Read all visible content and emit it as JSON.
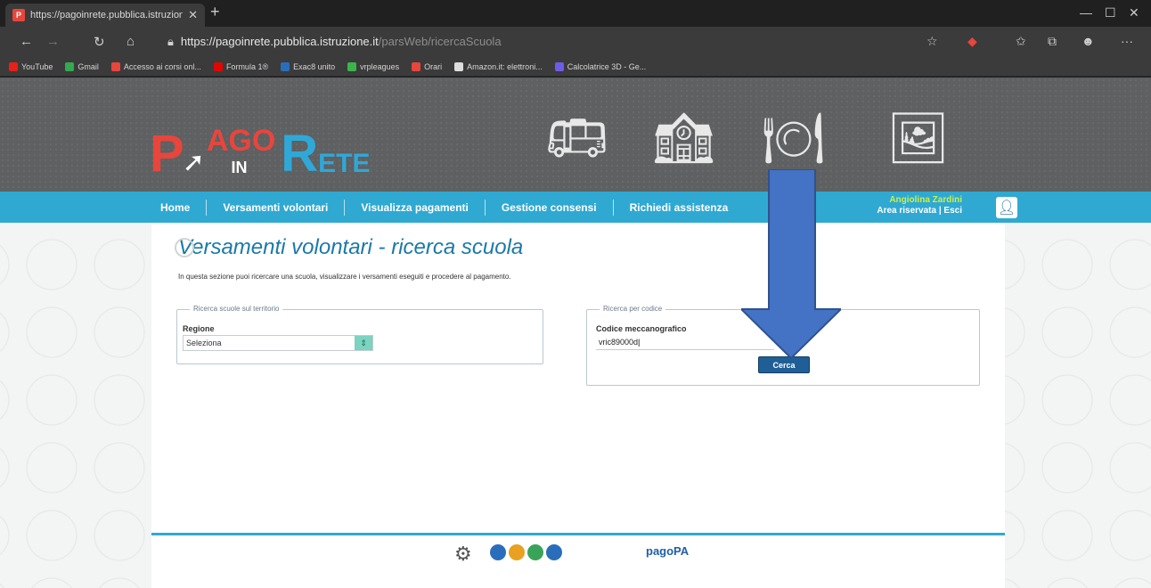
{
  "browser": {
    "tab_title": "https://pagoinrete.pubblica.istruzione.it",
    "new_tab": "+",
    "url_host": "https://pagoinrete.pubblica.istruzione.it",
    "url_path": "/parsWeb/ricercaScuola",
    "bookmarks": [
      {
        "label": "YouTube",
        "color": "#e62117"
      },
      {
        "label": "Gmail",
        "color": "#34a853"
      },
      {
        "label": "Accesso ai corsi onl...",
        "color": "#e8453c"
      },
      {
        "label": "Formula 1®",
        "color": "#e10600"
      },
      {
        "label": "Exac8 unito",
        "color": "#2a6ebb"
      },
      {
        "label": "vrpleagues",
        "color": "#3bb54a"
      },
      {
        "label": "Orari",
        "color": "#e8453c"
      },
      {
        "label": "Amazon.it: elettroni...",
        "color": "#dddddd"
      },
      {
        "label": "Calcolatrice 3D - Ge...",
        "color": "#6c5ce7"
      }
    ]
  },
  "site": {
    "logo": {
      "p1": "P",
      "p2": "AGO",
      "in": "IN",
      "r1": "R",
      "r2": "ETE"
    },
    "menu": [
      "Home",
      "Versamenti volontari",
      "Visualizza pagamenti",
      "Gestione consensi",
      "Richiedi assistenza"
    ],
    "user_name": "Angiolina Zardini",
    "user_area": "Area riservata",
    "logout": "Esci"
  },
  "main": {
    "title": "Versamenti volontari - ricerca scuola",
    "intro": "In questa sezione puoi ricercare una scuola, visualizzare i versamenti eseguiti e procedere al pagamento.",
    "territory": {
      "legend": "Ricerca scuole sul territorio",
      "region_label": "Regione",
      "region_value": "Seleziona"
    },
    "code": {
      "legend": "Ricerca per codice",
      "code_label": "Codice meccanografico",
      "code_value": "vric89000d",
      "search_button": "Cerca"
    }
  },
  "footer": {
    "pagopa": "pagoPA",
    "colors": [
      "#2a6ebb",
      "#e8a120",
      "#3aa35a",
      "#2a6ebb"
    ]
  },
  "annotation": {
    "arrow_color": "#4472c4"
  }
}
